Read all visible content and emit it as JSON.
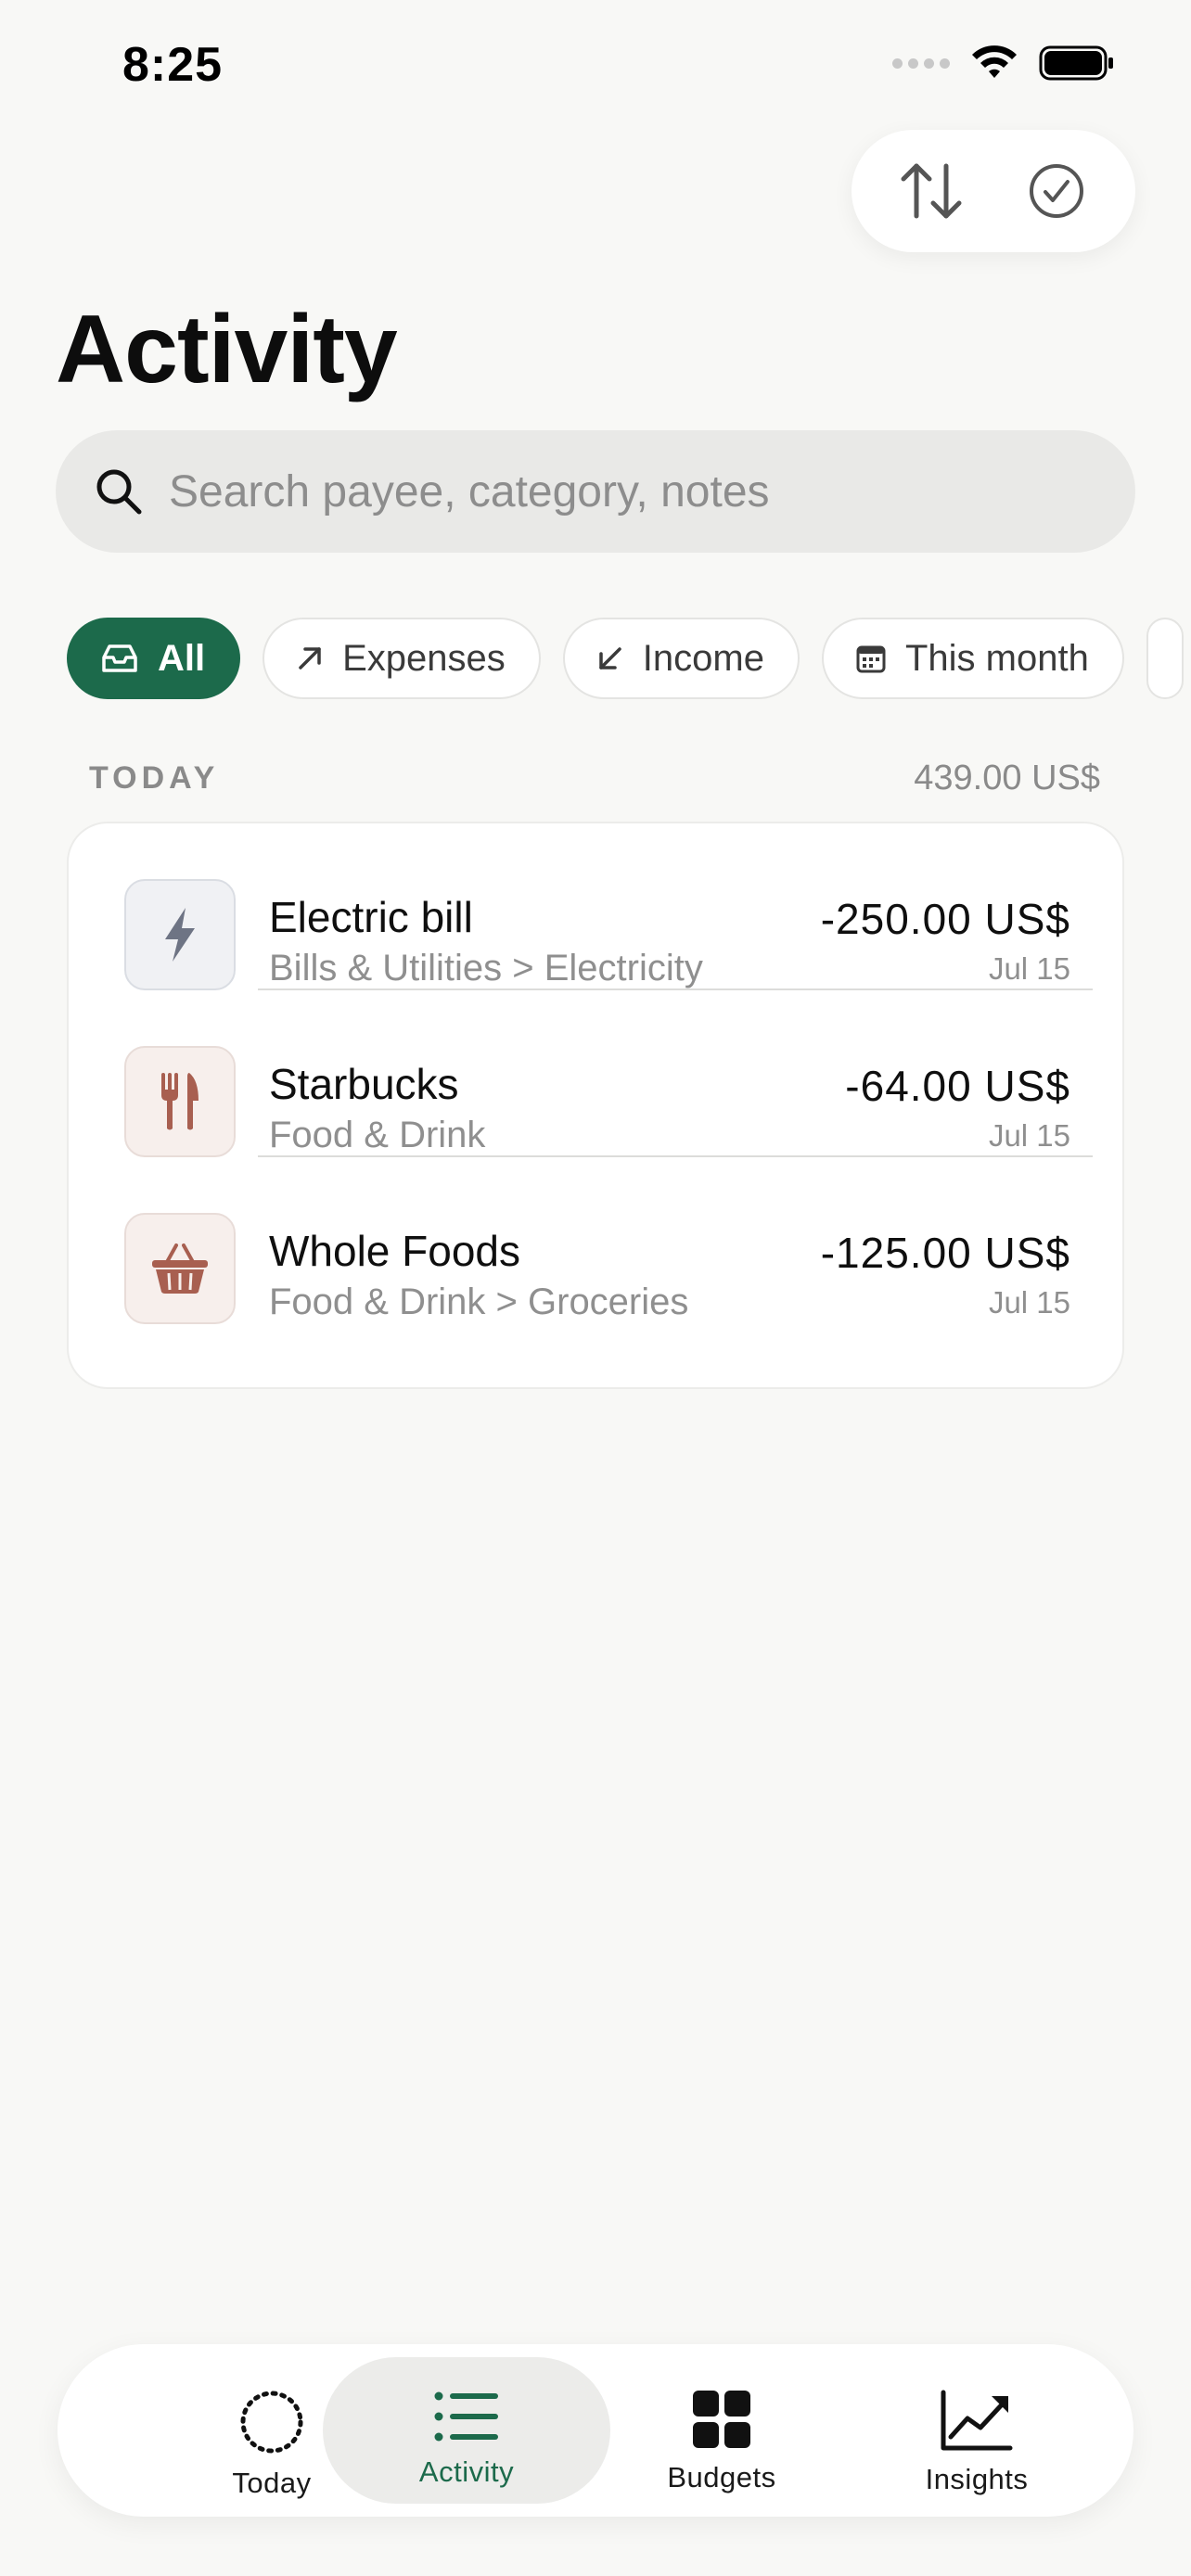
{
  "status_bar": {
    "time": "8:25"
  },
  "colors": {
    "accent": "#1c6a4b",
    "background": "#f8f8f6",
    "expense_red": "#a85f50"
  },
  "actions": [
    {
      "name": "sort",
      "icon": "sort-arrows-icon"
    },
    {
      "name": "select",
      "icon": "checkmark-circle-icon"
    }
  ],
  "page": {
    "title": "Activity"
  },
  "search": {
    "placeholder": "Search payee, category, notes",
    "value": ""
  },
  "filters": [
    {
      "label": "All",
      "icon": "tray-icon",
      "active": true
    },
    {
      "label": "Expenses",
      "icon": "arrow-up-right-icon",
      "active": false
    },
    {
      "label": "Income",
      "icon": "arrow-down-left-icon",
      "active": false
    },
    {
      "label": "This month",
      "icon": "calendar-icon",
      "active": false
    }
  ],
  "section": {
    "label": "TODAY",
    "total": "439.00 US$"
  },
  "transactions": [
    {
      "payee": "Electric bill",
      "category": "Bills & Utilities > Electricity",
      "amount": "-250.00 US$",
      "date": "Jul 15",
      "icon": "lightning-bolt-icon"
    },
    {
      "payee": "Starbucks",
      "category": "Food & Drink",
      "amount": "-64.00 US$",
      "date": "Jul 15",
      "icon": "fork-knife-icon"
    },
    {
      "payee": "Whole Foods",
      "category": "Food & Drink > Groceries",
      "amount": "-125.00 US$",
      "date": "Jul 15",
      "icon": "basket-icon"
    }
  ],
  "tabs": [
    {
      "label": "Today",
      "icon": "dotted-circle-icon",
      "active": false
    },
    {
      "label": "Activity",
      "icon": "list-icon",
      "active": true
    },
    {
      "label": "Budgets",
      "icon": "grid-icon",
      "active": false
    },
    {
      "label": "Insights",
      "icon": "chart-line-icon",
      "active": false
    }
  ]
}
